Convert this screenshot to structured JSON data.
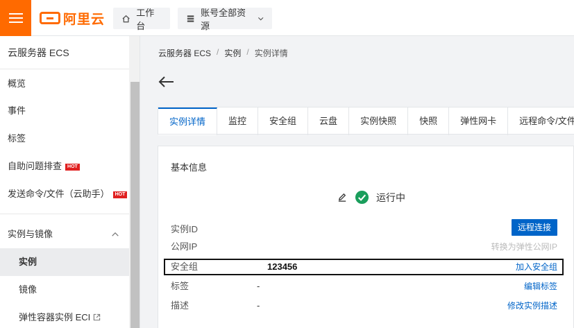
{
  "topbar": {
    "logo_text": "阿里云",
    "workbench_label": "工作台",
    "resources_label": "账号全部资源"
  },
  "sidebar": {
    "title": "云服务器 ECS",
    "items": [
      {
        "label": "概览"
      },
      {
        "label": "事件"
      },
      {
        "label": "标签"
      },
      {
        "label": "自助问题排查",
        "badge": "HOT"
      },
      {
        "label": "发送命令/文件（云助手）",
        "badge": "HOT"
      }
    ],
    "group": {
      "label": "实例与镜像"
    },
    "sub_items": [
      {
        "label": "实例"
      },
      {
        "label": "镜像"
      },
      {
        "label": "弹性容器实例 ECI"
      }
    ]
  },
  "breadcrumb": [
    "云服务器 ECS",
    "实例",
    "实例详情"
  ],
  "tabs": [
    "实例详情",
    "监控",
    "安全组",
    "云盘",
    "实例快照",
    "快照",
    "弹性网卡",
    "远程命令/文件"
  ],
  "panel": {
    "title": "基本信息",
    "status": "运行中",
    "rows": {
      "instance_id": {
        "label": "实例ID",
        "action": "远程连接"
      },
      "public_ip": {
        "label": "公网IP",
        "action": "转换为弹性公网IP"
      },
      "security_group": {
        "label": "安全组",
        "value": "123456",
        "action": "加入安全组"
      },
      "tags": {
        "label": "标签",
        "value": "-",
        "action": "编辑标签"
      },
      "description": {
        "label": "描述",
        "value": "-",
        "action": "修改实例描述"
      }
    }
  },
  "colors": {
    "brand": "#ff6a00",
    "link": "#0064c8",
    "success": "#1a9e5c",
    "hot": "#e02020"
  }
}
